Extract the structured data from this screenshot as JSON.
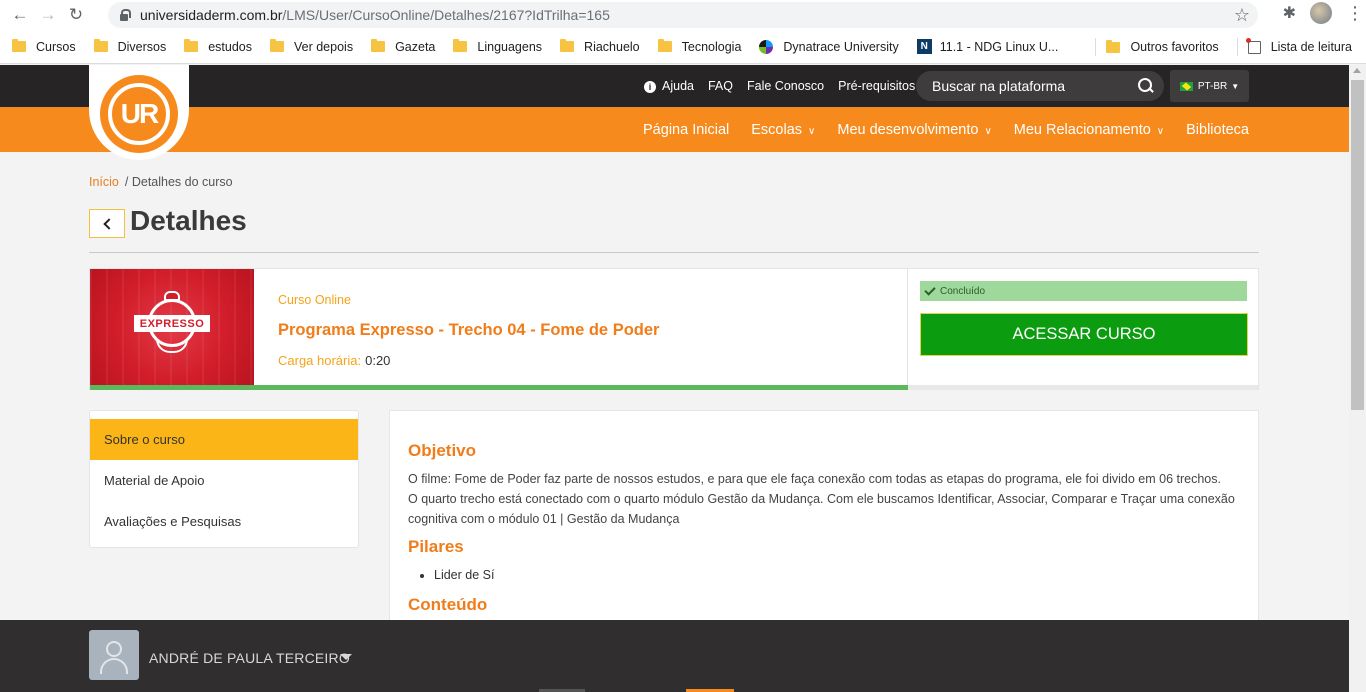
{
  "browser": {
    "url_host": "universidaderm.com.br",
    "url_path": "/LMS/User/CursoOnline/Detalhes/2167?IdTrilha=165",
    "bookmarks": [
      {
        "label": "Cursos",
        "icon": "folder-icon"
      },
      {
        "label": "Diversos",
        "icon": "folder-icon"
      },
      {
        "label": "estudos",
        "icon": "folder-icon"
      },
      {
        "label": "Ver depois",
        "icon": "folder-icon"
      },
      {
        "label": "Gazeta",
        "icon": "folder-icon"
      },
      {
        "label": "Linguagens",
        "icon": "folder-icon"
      },
      {
        "label": "Riachuelo",
        "icon": "folder-icon"
      },
      {
        "label": "Tecnologia",
        "icon": "folder-icon"
      },
      {
        "label": "Dynatrace University",
        "icon": "dynatrace-icon"
      },
      {
        "label": "11.1 - NDG Linux U...",
        "icon": "ndg-icon"
      }
    ],
    "other_favorites": "Outros favoritos",
    "reading_list": "Lista de leitura"
  },
  "header": {
    "logo_text": "UR",
    "help": "Ajuda",
    "faq": "FAQ",
    "contact": "Fale Conosco",
    "prereq": "Pré-requisitos",
    "search_placeholder": "Buscar na plataforma",
    "language": "PT-BR",
    "nav": {
      "home": "Página Inicial",
      "schools": "Escolas",
      "development": "Meu desenvolvimento",
      "relationship": "Meu Relacionamento",
      "library": "Biblioteca"
    },
    "colors": {
      "topbar": "#272425",
      "accent": "#f78a1d"
    }
  },
  "breadcrumb": {
    "home": "Início",
    "current": "/ Detalhes do curso"
  },
  "page": {
    "title": "Detalhes"
  },
  "course": {
    "thumb_label": "EXPRESSO",
    "type": "Curso Online",
    "title": "Programa Expresso - Trecho 04 - Fome de Poder",
    "hours_label": "Carga horária:",
    "hours_value": "0:20",
    "status": "Concluído",
    "access_button": "ACESSAR CURSO",
    "progress_fraction": 0.7
  },
  "side_menu": {
    "items": [
      "Sobre o curso",
      "Material de Apoio",
      "Avaliações e Pesquisas"
    ]
  },
  "content": {
    "objective_heading": "Objetivo",
    "objective_line1": "O filme: Fome de Poder faz parte de nossos estudos, e para que ele faça conexão com todas as etapas do programa, ele foi divido em 06 trechos.",
    "objective_line2": "O quarto trecho está conectado com o quarto módulo Gestão da Mudança. Com ele buscamos Identificar, Associar, Comparar e Traçar uma conexão cognitiva com o módulo 01 | Gestão da Mudança",
    "pillars_heading": "Pilares",
    "pillars": [
      "Lider de Sí"
    ],
    "content_heading": "Conteúdo"
  },
  "user": {
    "name": "ANDRÉ DE PAULA TERCEIRO"
  }
}
